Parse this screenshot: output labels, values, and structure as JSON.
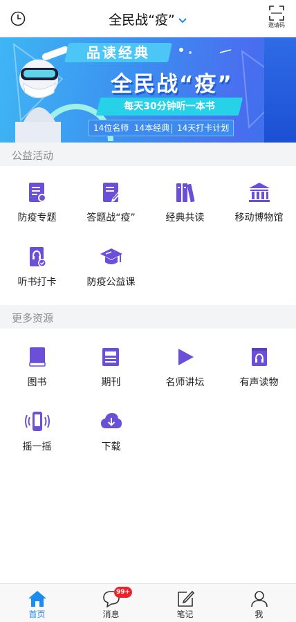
{
  "header": {
    "title": "全民战“疫”",
    "invite_label": "邀请码"
  },
  "banner": {
    "line1": "品读经典",
    "line2": "全民战“疫”",
    "line3": "每天30分钟听一本书",
    "stats": [
      "14位名师",
      "14本经典",
      "14天打卡计划"
    ]
  },
  "sections": [
    {
      "title": "公益活动",
      "items": [
        {
          "label": "防疫专题",
          "icon": "document-shield-icon"
        },
        {
          "label": "答题战“疫”",
          "icon": "document-pen-icon"
        },
        {
          "label": "经典共读",
          "icon": "books-icon"
        },
        {
          "label": "移动博物馆",
          "icon": "museum-icon"
        },
        {
          "label": "听书打卡",
          "icon": "headphone-book-icon"
        },
        {
          "label": "防疫公益课",
          "icon": "graduation-cap-icon"
        }
      ]
    },
    {
      "title": "更多资源",
      "items": [
        {
          "label": "图书",
          "icon": "book-icon"
        },
        {
          "label": "期刊",
          "icon": "newspaper-icon"
        },
        {
          "label": "名师讲坛",
          "icon": "play-icon"
        },
        {
          "label": "有声读物",
          "icon": "audio-book-icon"
        },
        {
          "label": "摇一摇",
          "icon": "shake-phone-icon"
        },
        {
          "label": "下载",
          "icon": "cloud-download-icon"
        }
      ]
    }
  ],
  "tabbar": {
    "tabs": [
      {
        "label": "首页",
        "icon": "home-icon",
        "active": true
      },
      {
        "label": "消息",
        "icon": "message-icon",
        "badge": "99+"
      },
      {
        "label": "笔记",
        "icon": "note-icon"
      },
      {
        "label": "我",
        "icon": "user-icon"
      }
    ]
  },
  "colors": {
    "accent": "#6b4fd8",
    "active_tab": "#1b8cf0",
    "badge": "#e8252c",
    "section_bg": "#f3f4f5"
  }
}
